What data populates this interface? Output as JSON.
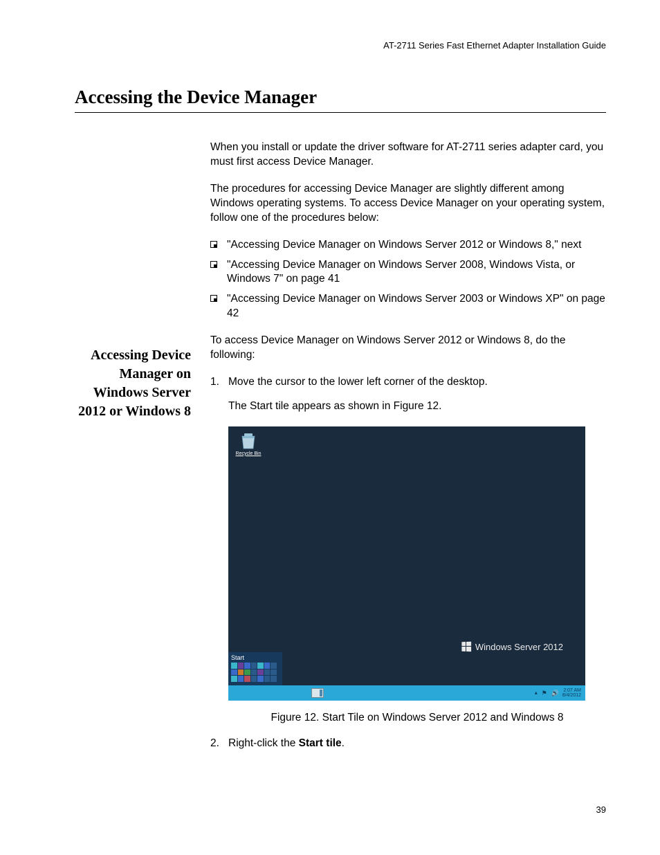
{
  "header": "AT-2711 Series Fast Ethernet Adapter Installation Guide",
  "title": "Accessing the Device Manager",
  "intro_p1": "When you install or update the driver software for AT-2711 series adapter card, you must first access Device Manager.",
  "intro_p2": "The procedures for accessing Device Manager are slightly different among Windows operating systems. To access Device Manager on your operating system, follow one of the procedures below:",
  "bullets": [
    "\"Accessing Device Manager on Windows Server 2012 or Windows 8,\" next",
    "\"Accessing Device Manager on Windows Server 2008, Windows Vista, or Windows 7\" on page 41",
    "\"Accessing Device Manager on Windows Server 2003 or Windows XP\" on page 42"
  ],
  "side_heading": "Accessing Device Manager on Windows Server 2012 or Windows 8",
  "section_intro": "To access Device Manager on Windows Server 2012 or Windows 8, do the following:",
  "steps": {
    "s1_num": "1.",
    "s1_text": "Move the cursor to the lower left corner of the desktop.",
    "s1_sub": "The Start tile appears as shown in Figure 12.",
    "s2_num": "2.",
    "s2_prefix": "Right-click the ",
    "s2_bold": "Start tile",
    "s2_suffix": "."
  },
  "screenshot": {
    "recycle_label": "Recycle Bin",
    "watermark": "Windows Server 2012",
    "start_label": "Start",
    "time": "2:07 AM",
    "date": "8/4/2012"
  },
  "figure_caption": "Figure 12. Start Tile on Windows Server 2012 and Windows 8",
  "page_number": "39"
}
